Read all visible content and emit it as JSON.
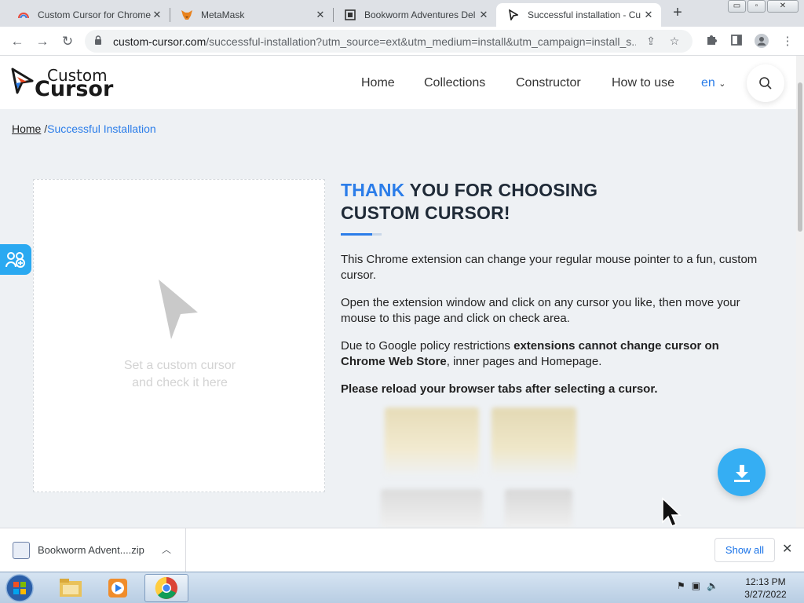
{
  "browser": {
    "tabs": [
      {
        "title": "Custom Cursor for Chrome",
        "icon": "rainbow-favicon"
      },
      {
        "title": "MetaMask",
        "icon": "fox-favicon"
      },
      {
        "title": "Bookworm Adventures Del",
        "icon": "film-favicon"
      },
      {
        "title": "Successful installation - Cu",
        "icon": "cursor-favicon",
        "active": true
      }
    ],
    "window_buttons": {
      "minimize": "▭",
      "restore": "▫",
      "close": "✕"
    },
    "url_host": "custom-cursor.com",
    "url_path": "/successful-installation?utm_source=ext&utm_medium=install&utm_campaign=install_s..."
  },
  "site": {
    "logo_line1": "Custom",
    "logo_line2": "Cursor",
    "nav": [
      "Home",
      "Collections",
      "Constructor",
      "How to use"
    ],
    "lang": "en"
  },
  "breadcrumb": {
    "home": "Home",
    "separator": "/",
    "current": "Successful Installation"
  },
  "check_area": {
    "hint_line1": "Set a custom cursor",
    "hint_line2": "and check it here"
  },
  "headline": {
    "accent": "THANK",
    "rest_line1": " YOU FOR CHOOSING",
    "line2": "CUSTOM CURSOR!"
  },
  "content": {
    "p1": "This Chrome extension can change your regular mouse pointer to a fun, custom cursor.",
    "p2": "Open the extension window and click on any cursor you like, then move your mouse to this page and click on check area.",
    "p3_start": "Due to Google policy restrictions ",
    "p3_bold": "extensions cannot change cursor on Chrome Web Store",
    "p3_end": ", inner pages and Homepage.",
    "p4": "Please reload your browser tabs after selecting a cursor."
  },
  "download_bar": {
    "file": "Bookworm Advent....zip",
    "show_all": "Show all"
  },
  "taskbar": {
    "time": "12:13 PM",
    "date": "3/27/2022"
  },
  "colors": {
    "accent": "#2b7de9",
    "fab": "#35aef3",
    "page_bg": "#eef1f4"
  }
}
